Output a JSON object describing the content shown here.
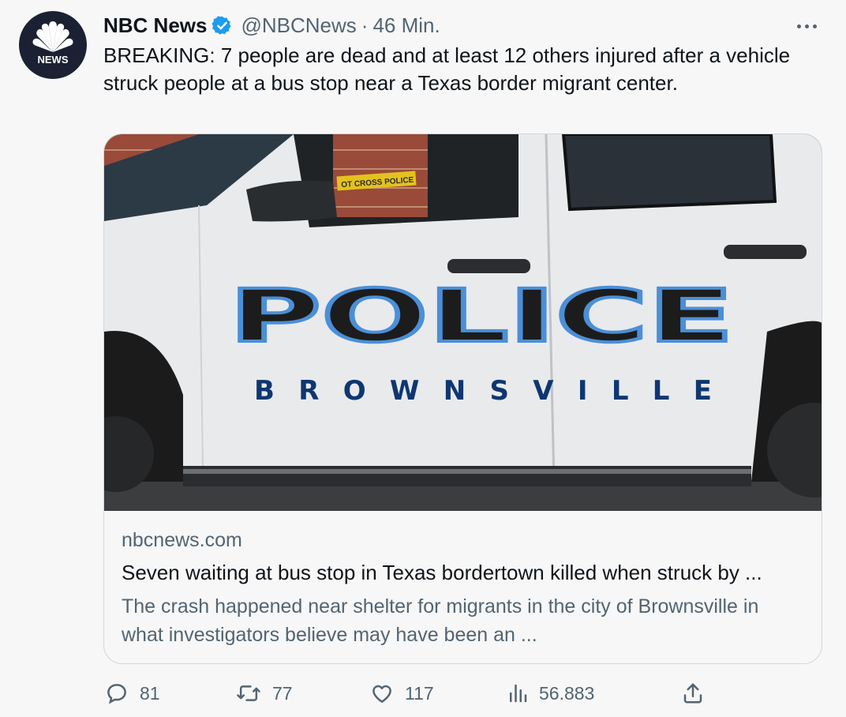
{
  "account": {
    "name": "NBC News",
    "handle": "@NBCNews",
    "separator": "·",
    "time": "46 Min.",
    "avatar_text": "NEWS"
  },
  "tweet": {
    "text": "BREAKING: 7 people are dead and at least 12 others injured after a vehicle struck people at a bus stop near a Texas border migrant center."
  },
  "card": {
    "image_lettering": {
      "police": "POLICE",
      "city": "BROWNSVILLE",
      "tape": "OT CROSS    POLICE"
    },
    "domain": "nbcnews.com",
    "title": "Seven waiting at bus stop in Texas bordertown killed when struck by ...",
    "description": "The crash happened near shelter for migrants in the city of Brownsville in what investigators believe may have been an ..."
  },
  "actions": {
    "reply_count": "81",
    "retweet_count": "77",
    "like_count": "117",
    "view_count": "56.883"
  },
  "icons": {
    "verified": "verified-badge-icon",
    "more": "more-icon",
    "reply": "reply-icon",
    "retweet": "retweet-icon",
    "like": "like-icon",
    "views": "views-icon",
    "share": "share-icon"
  },
  "colors": {
    "verified": "#1d9bf0",
    "secondary_text": "#536471",
    "avatar_bg": "#1b2133"
  }
}
